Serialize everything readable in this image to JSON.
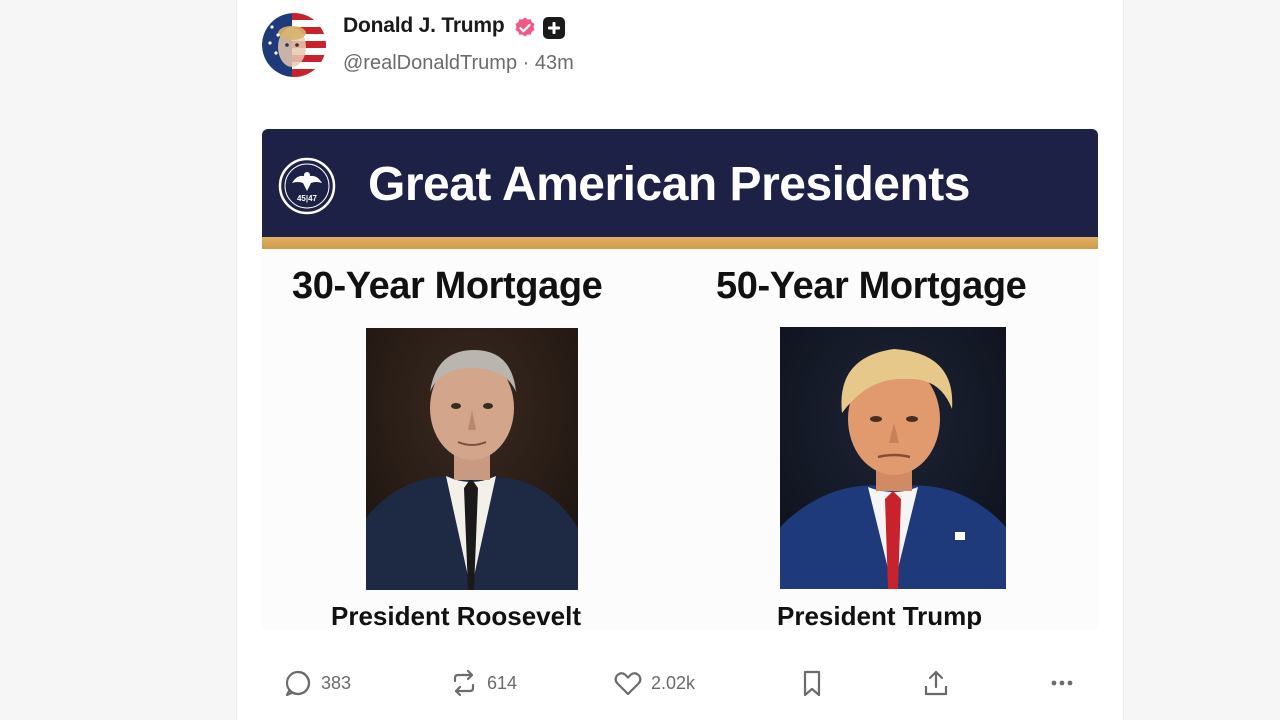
{
  "post": {
    "author": {
      "display_name": "Donald J. Trump",
      "handle": "@realDonaldTrump",
      "separator": "·",
      "time_ago": "43m",
      "verified_color": "#ef5a84",
      "icons": [
        "avatar-flag-portrait",
        "verified-badge-icon",
        "plus-badge-icon"
      ]
    },
    "image": {
      "banner_title": "Great American Presidents",
      "seal_text": "45|47",
      "left": {
        "heading": "30-Year Mortgage",
        "caption": "President Roosevelt"
      },
      "right": {
        "heading": "50-Year Mortgage",
        "caption": "President Trump"
      },
      "colors": {
        "banner": "#1c2145",
        "stripe": "#d9a85a"
      }
    },
    "actions": {
      "replies": "383",
      "reposts": "614",
      "likes": "2.02k",
      "icons": [
        "reply-icon",
        "repost-icon",
        "like-icon",
        "bookmark-icon",
        "share-icon",
        "more-icon"
      ]
    }
  }
}
